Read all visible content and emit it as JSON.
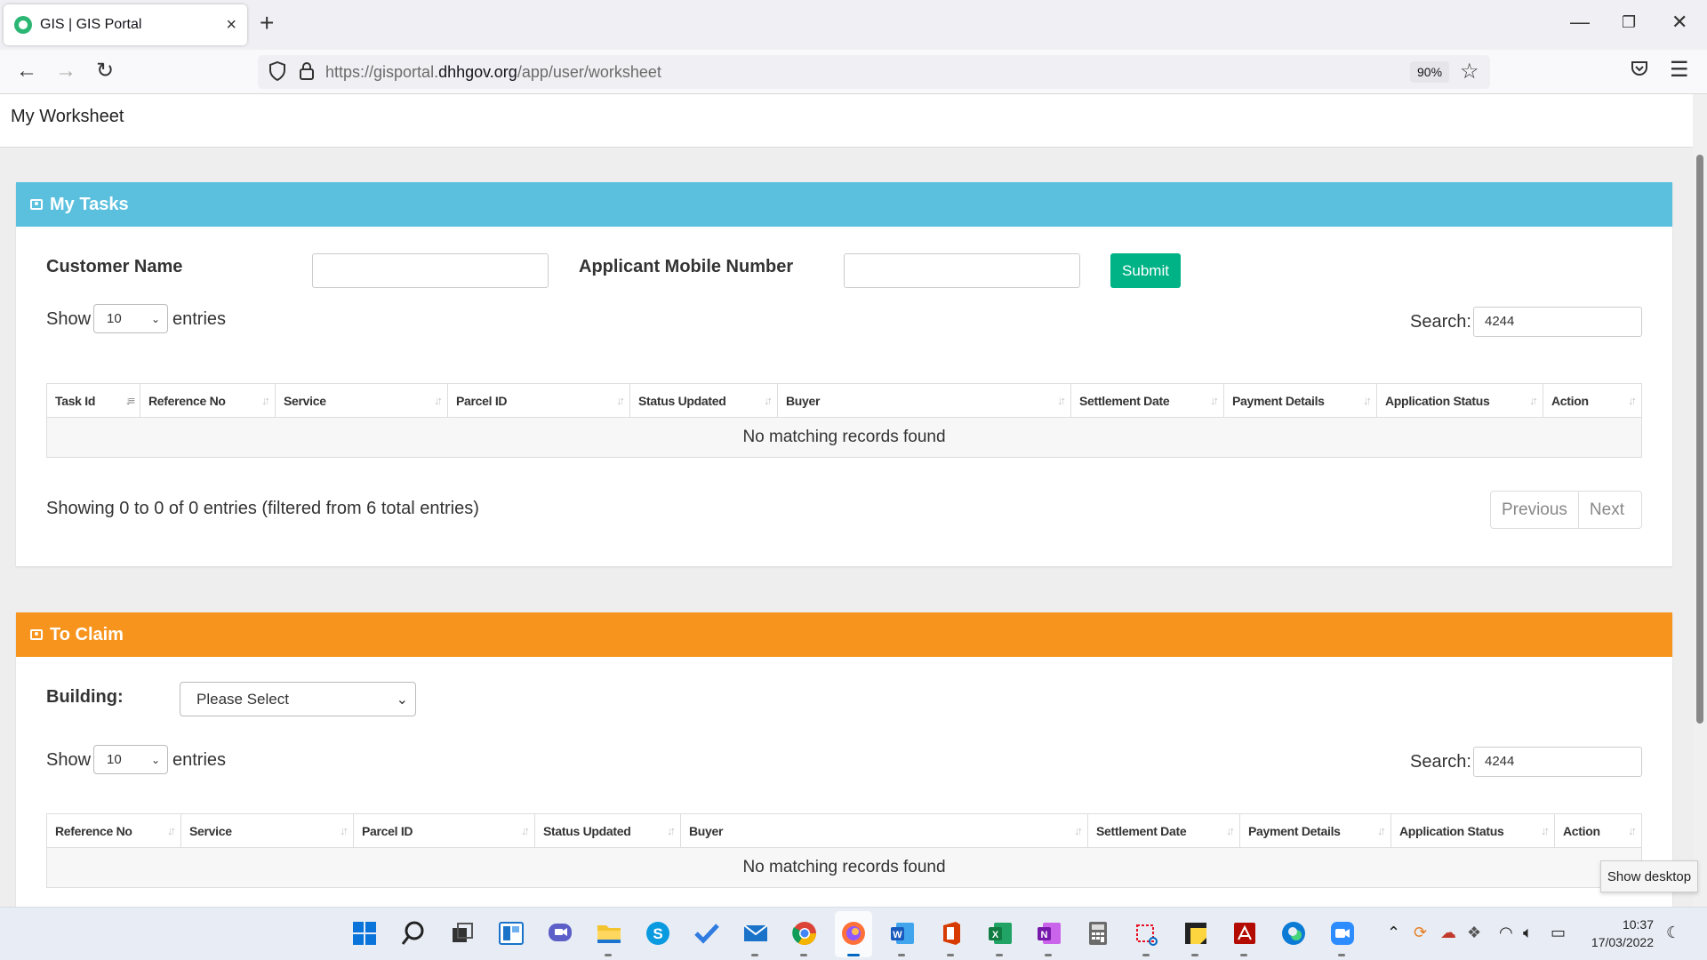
{
  "browser": {
    "tab_title": "GIS | GIS Portal",
    "url_prefix": "https://gisportal.",
    "url_domain": "dhhgov.org",
    "url_path": "/app/user/worksheet",
    "zoom": "90%"
  },
  "page": {
    "title": "My Worksheet"
  },
  "my_tasks": {
    "heading": "My Tasks",
    "customer_name_label": "Customer Name",
    "mobile_label": "Applicant Mobile Number",
    "customer_name_value": "",
    "mobile_value": "",
    "submit_label": "Submit",
    "show_label": "Show",
    "entries_label": "entries",
    "page_size": "10",
    "search_label": "Search:",
    "search_value": "4244",
    "columns": [
      "Task Id",
      "Reference No",
      "Service",
      "Parcel ID",
      "Status Updated",
      "Buyer",
      "Settlement Date",
      "Payment Details",
      "Application Status",
      "Action"
    ],
    "empty_message": "No matching records found",
    "info": "Showing 0 to 0 of 0 entries (filtered from 6 total entries)",
    "prev_label": "Previous",
    "next_label": "Next"
  },
  "to_claim": {
    "heading": "To Claim",
    "building_label": "Building:",
    "building_value": "Please Select",
    "show_label": "Show",
    "entries_label": "entries",
    "page_size": "10",
    "search_label": "Search:",
    "search_value": "4244",
    "columns": [
      "Reference No",
      "Service",
      "Parcel ID",
      "Status Updated",
      "Buyer",
      "Settlement Date",
      "Payment Details",
      "Application Status",
      "Action"
    ],
    "empty_message": "No matching records found"
  },
  "tooltip": "Show desktop",
  "taskbar": {
    "time": "10:37",
    "date": "17/03/2022"
  },
  "colors": {
    "my_tasks_header": "#5bc0de",
    "to_claim_header": "#f7941d",
    "submit_button": "#00b386"
  }
}
